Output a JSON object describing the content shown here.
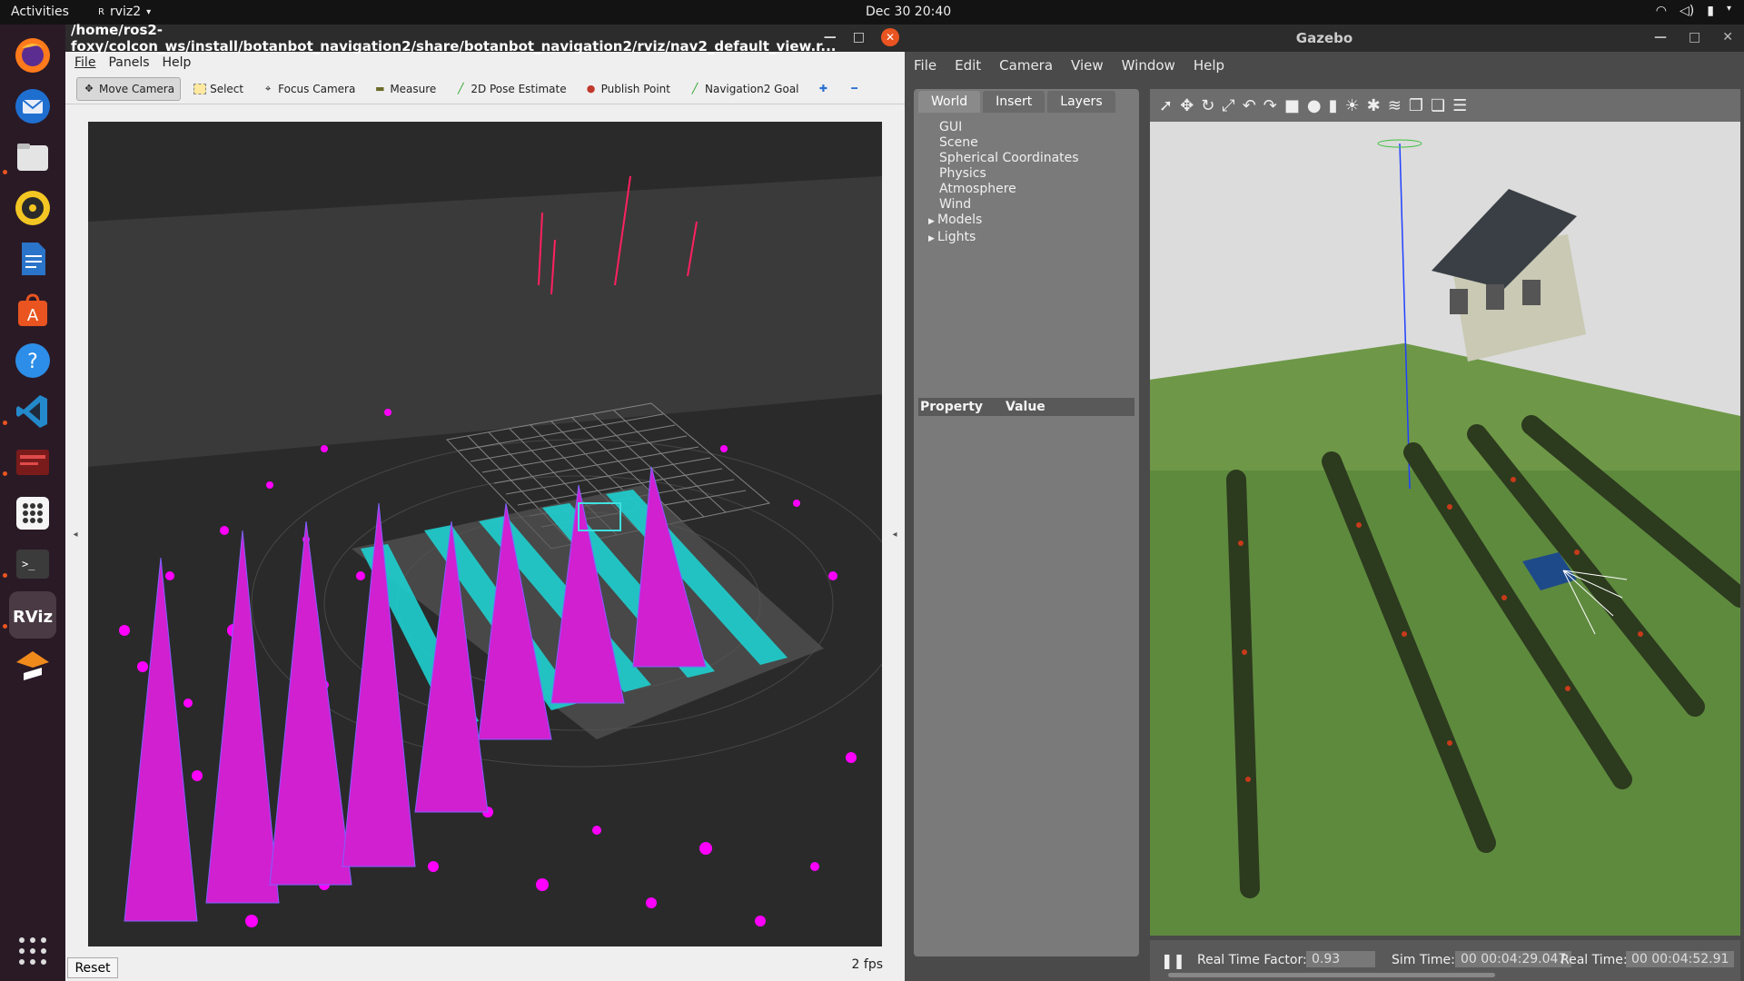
{
  "topbar": {
    "activities": "Activities",
    "app_name": "rviz2",
    "clock": "Dec 30  20:40"
  },
  "dock": {
    "items": [
      "firefox-icon",
      "thunderbird-icon",
      "files-icon",
      "rhythmbox-icon",
      "writer-icon",
      "software-icon",
      "help-icon",
      "vscode-icon",
      "terminal-red-icon",
      "apps-grid-icon",
      "terminal-icon",
      "rviz-icon",
      "blender-icon"
    ]
  },
  "rviz": {
    "title": "/home/ros2-foxy/colcon_ws/install/botanbot_navigation2/share/botanbot_navigation2/rviz/nav2_default_view.r...",
    "menu": [
      "File",
      "Panels",
      "Help"
    ],
    "tools": [
      "Move Camera",
      "Select",
      "Focus Camera",
      "Measure",
      "2D Pose Estimate",
      "Publish Point",
      "Navigation2 Goal"
    ],
    "reset": "Reset",
    "fps": "2 fps"
  },
  "gazebo": {
    "title": "Gazebo",
    "menu": [
      "File",
      "Edit",
      "Camera",
      "View",
      "Window",
      "Help"
    ],
    "tabs": [
      "World",
      "Insert",
      "Layers"
    ],
    "tree": [
      "GUI",
      "Scene",
      "Spherical Coordinates",
      "Physics",
      "Atmosphere",
      "Wind",
      "Models",
      "Lights"
    ],
    "property_header": "Property",
    "value_header": "Value",
    "rtf_label": "Real Time Factor:",
    "rtf_value": "0.93",
    "sim_label": "Sim Time:",
    "sim_value": "00 00:04:29.047",
    "real_label": "Real Time:",
    "real_value": "00 00:04:52.91"
  }
}
